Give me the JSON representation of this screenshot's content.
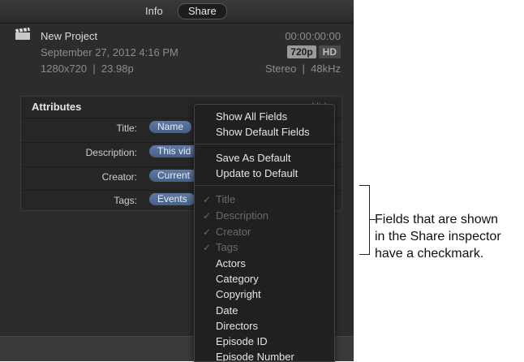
{
  "tabs": {
    "info": "Info",
    "share": "Share"
  },
  "project": {
    "name": "New Project",
    "date": "September 27, 2012 4:16 PM",
    "resolution": "1280x720  |  23.98p",
    "timecode": "00:00:00:00",
    "badge_quality": "720p",
    "badge_hd": "HD",
    "audio": "Stereo  |  48kHz"
  },
  "attributes": {
    "title": "Attributes",
    "hide": "Hide",
    "rows": [
      {
        "label": "Title:",
        "token": "Name"
      },
      {
        "label": "Description:",
        "token": "This vid"
      },
      {
        "label": "Creator:",
        "token": "Current"
      },
      {
        "label": "Tags:",
        "token": "Events"
      }
    ]
  },
  "menu": {
    "show_all": "Show All Fields",
    "show_default": "Show Default Fields",
    "save_default": "Save As Default",
    "update_default": "Update to Default",
    "checked": [
      "Title",
      "Description",
      "Creator",
      "Tags"
    ],
    "fields": [
      "Actors",
      "Category",
      "Copyright",
      "Date",
      "Directors",
      "Episode ID",
      "Episode Number"
    ]
  },
  "callout": {
    "line1": "Fields that are shown",
    "line2": "in the Share inspector",
    "line3": "have a checkmark."
  },
  "colors": {
    "token": "#5270a0",
    "panel": "#2c2c2c",
    "menu": "#202020"
  }
}
